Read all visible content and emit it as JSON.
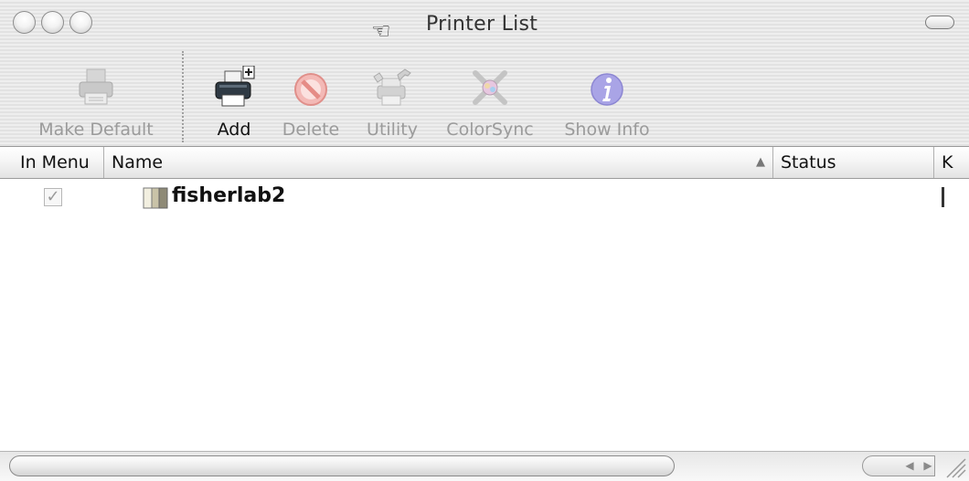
{
  "window": {
    "title": "Printer List"
  },
  "toolbar": {
    "items": [
      {
        "label": "Make Default",
        "icon": "printer-default-icon",
        "enabled": false
      },
      {
        "label": "Add",
        "icon": "add-printer-icon",
        "enabled": true
      },
      {
        "label": "Delete",
        "icon": "delete-icon",
        "enabled": false
      },
      {
        "label": "Utility",
        "icon": "utility-icon",
        "enabled": false
      },
      {
        "label": "ColorSync",
        "icon": "colorsync-icon",
        "enabled": false
      },
      {
        "label": "Show Info",
        "icon": "info-icon",
        "enabled": false
      }
    ]
  },
  "list": {
    "columns": [
      {
        "label": "In Menu"
      },
      {
        "label": "Name",
        "sorted": "ascending"
      },
      {
        "label": "Status"
      },
      {
        "label": "K"
      }
    ],
    "rows": [
      {
        "in_menu": true,
        "name": "fisherlab2",
        "status": ""
      }
    ]
  },
  "colors": {
    "chrome_light": "#eeeeee",
    "chrome_dark": "#e2e2e2",
    "disabled_text": "#9b9b9b",
    "active_text": "#111111"
  }
}
